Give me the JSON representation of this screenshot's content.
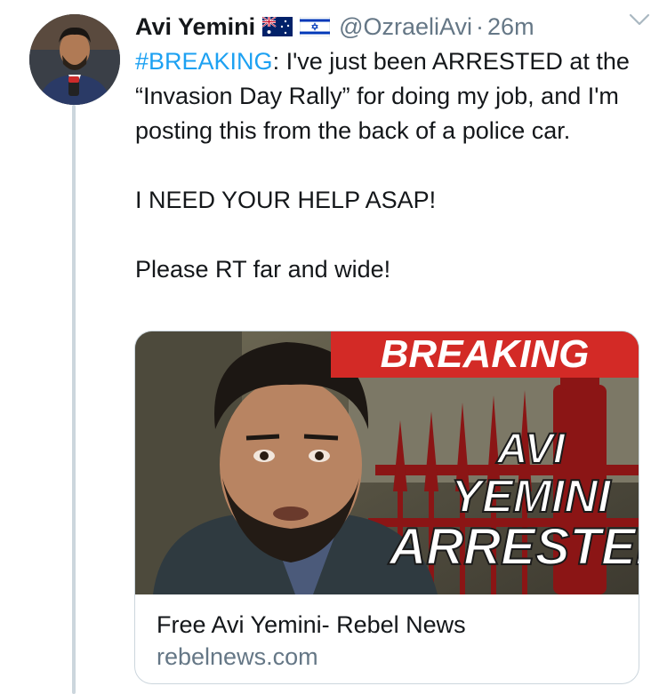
{
  "tweet": {
    "author_name": "Avi Yemini",
    "flags": [
      "australia-flag-icon",
      "israel-flag-icon"
    ],
    "handle": "@OzraeliAvi",
    "separator": "·",
    "time": "26m",
    "hashtag": "#BREAKING",
    "line1_rest": ": I've just been ARRESTED at the “Invasion Day Rally” for doing my job, and I'm posting this from the back of a police car.",
    "line2": "I NEED YOUR HELP ASAP!",
    "line3": "Please RT far and wide!"
  },
  "card": {
    "banner": "BREAKING",
    "headline_lines": [
      "AVI",
      "YEMINI",
      "ARRESTED"
    ],
    "title": "Free Avi Yemini- Rebel News",
    "domain": "rebelnews.com"
  },
  "colors": {
    "link": "#1da1f2",
    "muted": "#657786",
    "banner_red": "#d32a26",
    "border": "#ccd6dd"
  }
}
